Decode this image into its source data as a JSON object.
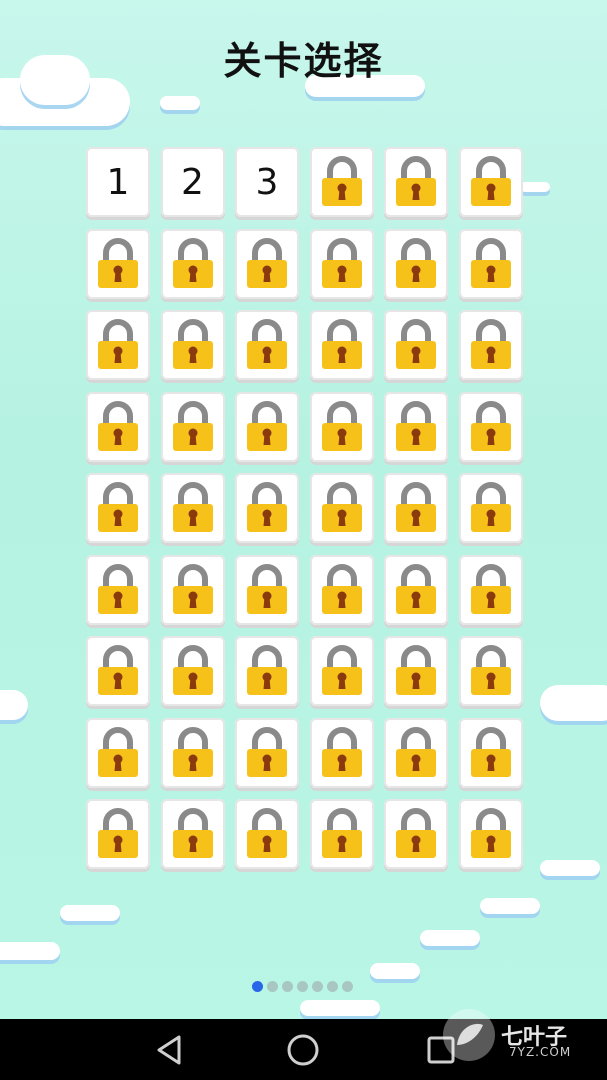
{
  "header": {
    "title": "关卡选择"
  },
  "levels": {
    "columns": 6,
    "rows": 9,
    "unlocked": [
      "1",
      "2",
      "3"
    ],
    "locked_count": 51,
    "lock_icon": "padlock-icon"
  },
  "pager": {
    "page_count": 7,
    "active_index": 0
  },
  "nav": {
    "back_icon": "back-triangle-icon",
    "home_icon": "home-circle-icon",
    "recents_icon": "recents-square-icon"
  },
  "watermark": {
    "text": "七叶子",
    "sub": "7YZ.COM"
  },
  "colors": {
    "background": "#b9f6e6",
    "lock_body": "#f6c21a",
    "lock_shackle": "#8a8a8a",
    "keyhole": "#8b3a0e",
    "active_dot": "#2a66e8",
    "inactive_dot": "#a9c7c2"
  }
}
